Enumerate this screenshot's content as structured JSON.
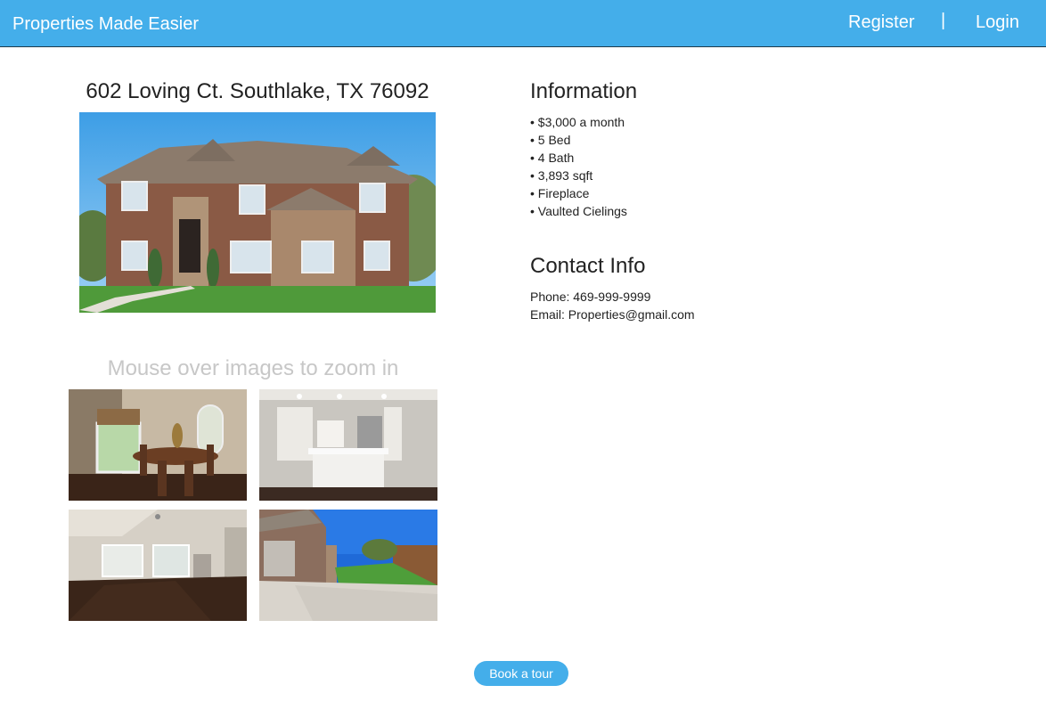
{
  "nav": {
    "brand": "Properties Made Easier",
    "register": "Register",
    "separator": "|",
    "login": "Login"
  },
  "listing": {
    "address": "602 Loving Ct. Southlake, TX 76092",
    "zoom_hint": "Mouse over images to zoom in"
  },
  "information": {
    "title": "Information",
    "items": [
      "$3,000 a month",
      "5 Bed",
      "4 Bath",
      "3,893 sqft",
      "Fireplace",
      "Vaulted Cielings"
    ]
  },
  "contact": {
    "title": "Contact Info",
    "phone": "Phone: 469-999-9999",
    "email": "Email: Properties@gmail.com"
  },
  "actions": {
    "book_label": "Book a tour"
  },
  "colors": {
    "accent": "#44aeea",
    "hint_text": "#c7c7c7"
  },
  "icons": {
    "hero": "house-exterior-photo",
    "thumb1": "dining-room-photo",
    "thumb2": "kitchen-photo",
    "thumb3": "living-room-photo",
    "thumb4": "backyard-photo"
  }
}
